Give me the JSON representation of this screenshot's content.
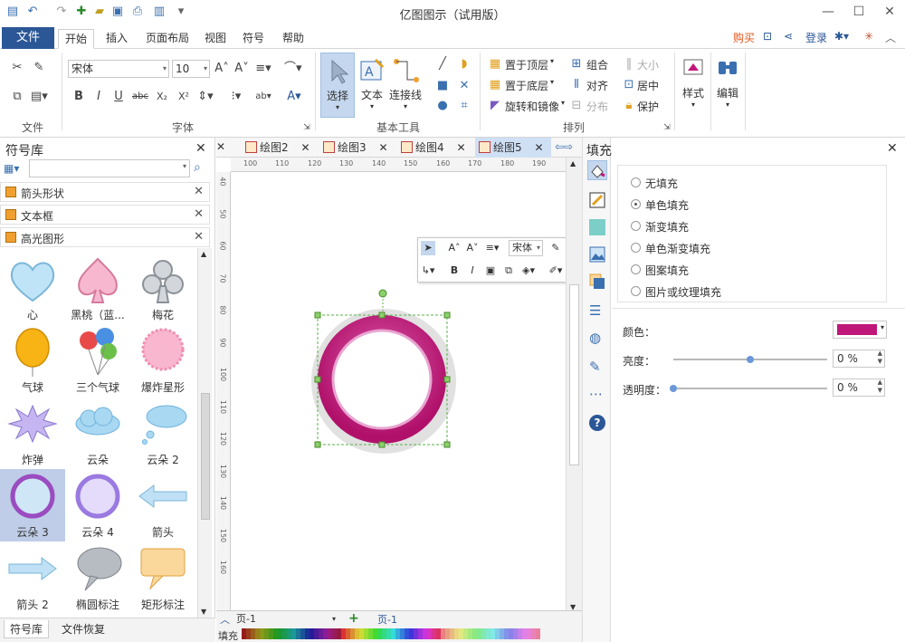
{
  "app_title": "亿图图示（试用版）",
  "menu": {
    "file": "文件",
    "tabs": [
      "开始",
      "插入",
      "页面布局",
      "视图",
      "符号",
      "帮助"
    ],
    "buy": "购买",
    "login": "登录"
  },
  "ribbon": {
    "font_name": "宋体",
    "font_size": "10",
    "select_label": "选择",
    "text_label": "文本",
    "connector_label": "连接线",
    "bring_front": "置于顶层",
    "send_back": "置于底层",
    "rotate_mirror": "旋转和镜像",
    "group": "组合",
    "align": "对齐",
    "distribute": "分布",
    "size": "大小",
    "center": "居中",
    "protect": "保护",
    "style_label": "样式",
    "edit_label": "编辑",
    "groups": {
      "file": "文件",
      "font": "字体",
      "basic_tools": "基本工具",
      "arrange": "排列"
    }
  },
  "library": {
    "title": "符号库",
    "categories": [
      "箭头形状",
      "文本框",
      "高光图形"
    ],
    "shapes": [
      {
        "label": "心"
      },
      {
        "label": "黑桃（蓝..."
      },
      {
        "label": "梅花"
      },
      {
        "label": "气球"
      },
      {
        "label": "三个气球"
      },
      {
        "label": "爆炸星形"
      },
      {
        "label": "炸弹"
      },
      {
        "label": "云朵"
      },
      {
        "label": "云朵 2"
      },
      {
        "label": "云朵 3"
      },
      {
        "label": "云朵 4"
      },
      {
        "label": "箭头"
      },
      {
        "label": "箭头 2"
      },
      {
        "label": "椭圆标注"
      },
      {
        "label": "矩形标注"
      }
    ],
    "bottom_tabs": [
      "符号库",
      "文件恢复"
    ]
  },
  "doc_tabs": [
    "绘图2",
    "绘图3",
    "绘图4",
    "绘图5"
  ],
  "active_doc_tab": "绘图5",
  "ruler_h": [
    "100",
    "110",
    "120",
    "130",
    "140",
    "150",
    "160",
    "170",
    "180",
    "190"
  ],
  "ruler_v": [
    "40",
    "50",
    "60",
    "70",
    "80",
    "90",
    "100",
    "110",
    "120",
    "130",
    "140",
    "150",
    "160"
  ],
  "floatbar": {
    "font": "宋体"
  },
  "pagebar": {
    "page_select": "页-1",
    "page_tab": "页-1"
  },
  "colorbar_label": "填充",
  "fill_panel": {
    "title": "填充",
    "options": [
      "无填充",
      "单色填充",
      "渐变填充",
      "单色渐变填充",
      "图案填充",
      "图片或纹理填充"
    ],
    "selected_index": 1,
    "color_label": "颜色：",
    "color_value": "#c0177a",
    "brightness_label": "亮度：",
    "brightness_value": "0 %",
    "brightness_fraction": 0.5,
    "transparency_label": "透明度：",
    "transparency_value": "0 %",
    "transparency_fraction": 0.0
  },
  "colors": {
    "accent_blue": "#2b5797",
    "ring_outer": "#c0177a",
    "ring_inner": "#d96db3",
    "buy": "#e2571e",
    "login": "#2b5797"
  }
}
